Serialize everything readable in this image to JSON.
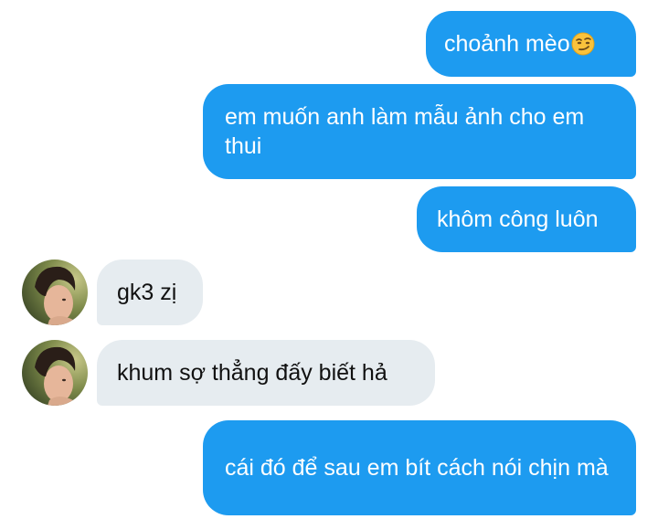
{
  "conversation": {
    "messages": [
      {
        "sender": "me",
        "text": "choảnh mèo",
        "emoji": "smirking-face-emoji"
      },
      {
        "sender": "me",
        "text": "em muốn anh làm mẫu ảnh cho em thui"
      },
      {
        "sender": "me",
        "text": "khôm công luôn"
      },
      {
        "sender": "them",
        "text": "gk3 zị"
      },
      {
        "sender": "them",
        "text": "khum sợ thẳng đấy biết hả"
      },
      {
        "sender": "me",
        "text": "cái đó để sau em bít cách nói chịn mà"
      }
    ]
  },
  "colors": {
    "sent_bubble": "#1d9bf0",
    "received_bubble": "#e6ecf0"
  }
}
